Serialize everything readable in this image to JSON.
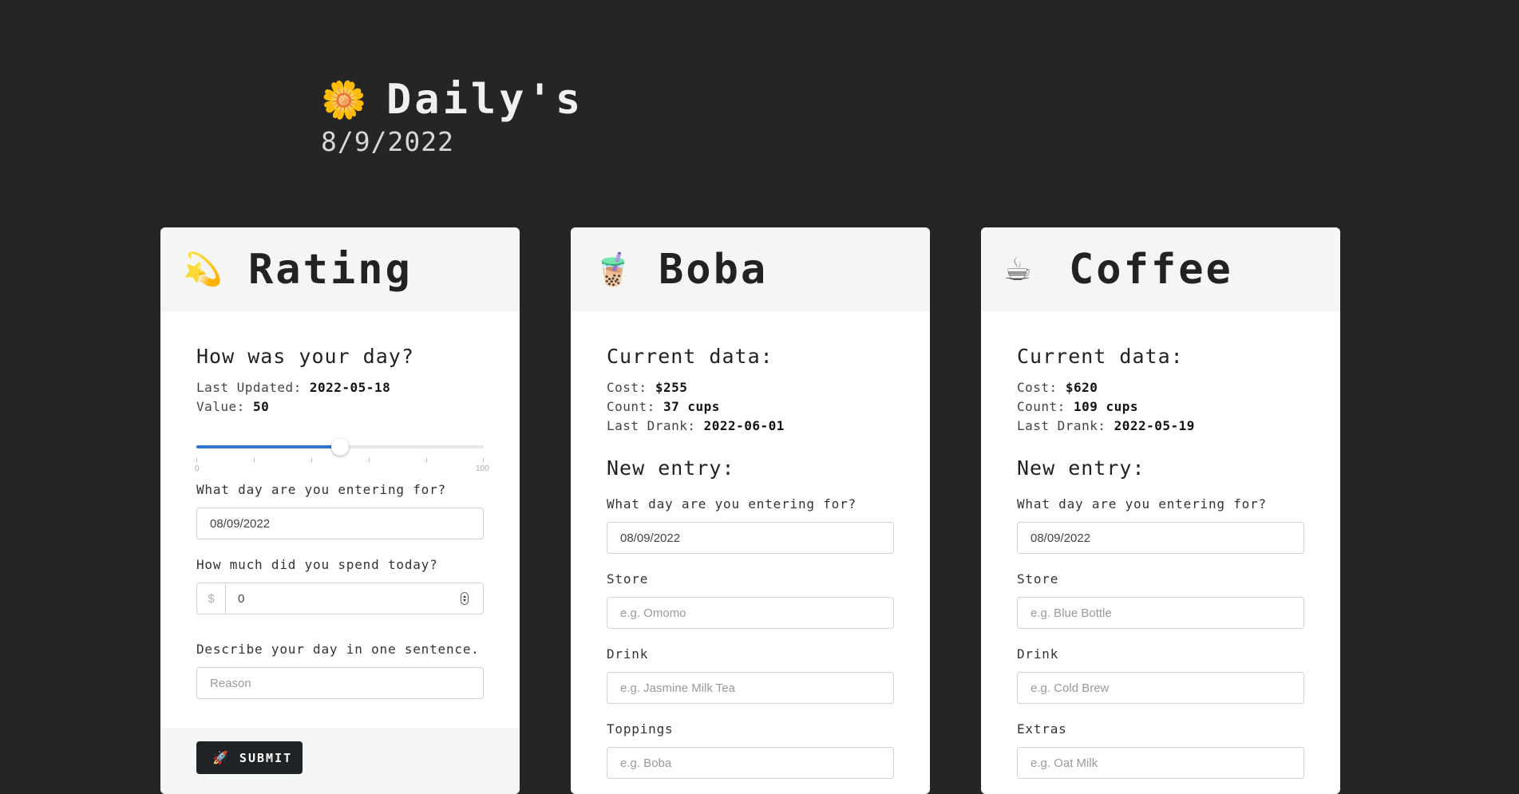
{
  "header": {
    "logo_icon": "🌼",
    "title": "Daily's",
    "date": "8/9/2022"
  },
  "rating": {
    "icon": "💫",
    "title": "Rating",
    "section_title": "How was your day?",
    "last_updated_label": "Last Updated:",
    "last_updated_value": "2022-05-18",
    "value_label": "Value:",
    "value": "50",
    "slider": {
      "value": 50,
      "min": 0,
      "max": 100,
      "min_label": "0",
      "max_label": "100"
    },
    "day_label": "What day are you entering for?",
    "day_value": "08/09/2022",
    "spend_label": "How much did you spend today?",
    "spend_prefix": "$",
    "spend_value": "0",
    "describe_label": "Describe your day in one sentence.",
    "describe_placeholder": "Reason",
    "submit_icon": "🚀",
    "submit_label": "SUBMIT"
  },
  "boba": {
    "icon": "🧋",
    "title": "Boba",
    "current_title": "Current data:",
    "cost_label": "Cost:",
    "cost_value": "$255",
    "count_label": "Count:",
    "count_value": "37 cups",
    "last_drank_label": "Last Drank:",
    "last_drank_value": "2022-06-01",
    "new_entry_title": "New entry:",
    "day_label": "What day are you entering for?",
    "day_value": "08/09/2022",
    "store_label": "Store",
    "store_placeholder": "e.g. Omomo",
    "drink_label": "Drink",
    "drink_placeholder": "e.g. Jasmine Milk Tea",
    "extra_label": "Toppings",
    "extra_placeholder": "e.g. Boba"
  },
  "coffee": {
    "icon": "☕",
    "title": "Coffee",
    "current_title": "Current data:",
    "cost_label": "Cost:",
    "cost_value": "$620",
    "count_label": "Count:",
    "count_value": "109 cups",
    "last_drank_label": "Last Drank:",
    "last_drank_value": "2022-05-19",
    "new_entry_title": "New entry:",
    "day_label": "What day are you entering for?",
    "day_value": "08/09/2022",
    "store_label": "Store",
    "store_placeholder": "e.g. Blue Bottle",
    "drink_label": "Drink",
    "drink_placeholder": "e.g. Cold Brew",
    "extra_label": "Extras",
    "extra_placeholder": "e.g. Oat Milk"
  },
  "colors": {
    "background": "#252525",
    "card": "#ffffff",
    "card_header": "#f4f5f5",
    "accent": "#2f74d0",
    "button": "#1f2325"
  }
}
